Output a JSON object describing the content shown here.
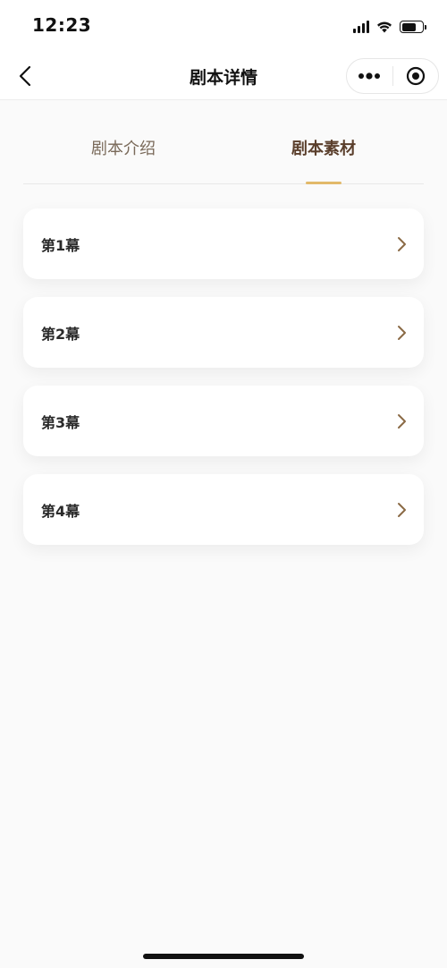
{
  "status_bar": {
    "time": "12:23"
  },
  "nav": {
    "title": "剧本详情",
    "back_icon": "chevron-left-icon",
    "more_icon": "more-dots-icon",
    "close_icon": "target-circle-icon"
  },
  "tabs": [
    {
      "label": "剧本介绍",
      "active": false
    },
    {
      "label": "剧本素材",
      "active": true
    }
  ],
  "acts": [
    {
      "label": "第1幕"
    },
    {
      "label": "第2幕"
    },
    {
      "label": "第3幕"
    },
    {
      "label": "第4幕"
    }
  ],
  "colors": {
    "accent": "#e2b96a",
    "active_tab_text": "#5a3e2b",
    "inactive_tab_text": "#7a6a5a",
    "chevron": "#8a6a45"
  }
}
